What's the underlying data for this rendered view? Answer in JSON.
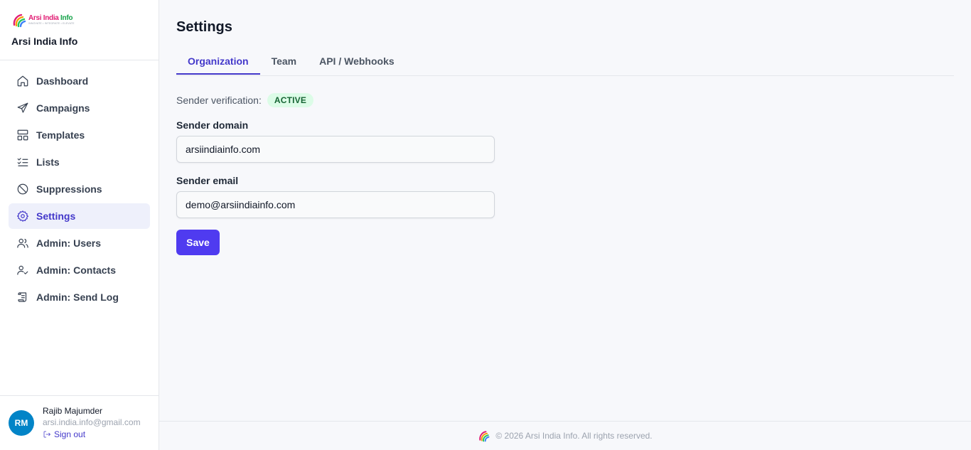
{
  "brand": {
    "logo_title_part1": "Arsi India",
    "logo_title_part2": " Info",
    "logo_tagline": "INNOVATE • INTEGRATE • ELEVATE",
    "name": "Arsi India Info"
  },
  "sidebar": {
    "items": [
      {
        "label": "Dashboard",
        "icon": "home-icon"
      },
      {
        "label": "Campaigns",
        "icon": "send-icon"
      },
      {
        "label": "Templates",
        "icon": "layout-icon"
      },
      {
        "label": "Lists",
        "icon": "list-checks-icon"
      },
      {
        "label": "Suppressions",
        "icon": "ban-icon"
      },
      {
        "label": "Settings",
        "icon": "gear-icon",
        "active": true
      },
      {
        "label": "Admin: Users",
        "icon": "users-icon"
      },
      {
        "label": "Admin: Contacts",
        "icon": "user-check-icon"
      },
      {
        "label": "Admin: Send Log",
        "icon": "scroll-icon"
      }
    ]
  },
  "user": {
    "initials": "RM",
    "name": "Rajib Majumder",
    "email": "arsi.india.info@gmail.com",
    "signout_label": "Sign out"
  },
  "page": {
    "title": "Settings",
    "tabs": [
      {
        "label": "Organization",
        "active": true
      },
      {
        "label": "Team"
      },
      {
        "label": "API / Webhooks"
      }
    ]
  },
  "form": {
    "verification_label": "Sender verification:",
    "verification_status": "ACTIVE",
    "domain_label": "Sender domain",
    "domain_value": "arsiindiainfo.com",
    "email_label": "Sender email",
    "email_value": "demo@arsiindiainfo.com",
    "save_label": "Save"
  },
  "footer": {
    "copyright": "© 2026 Arsi India Info. All rights reserved."
  },
  "colors": {
    "accent": "#4f3bf0",
    "active_nav_bg": "#eef0fb",
    "badge_bg": "#dcfce7",
    "badge_text": "#166534",
    "avatar_bg": "#0284c7"
  }
}
